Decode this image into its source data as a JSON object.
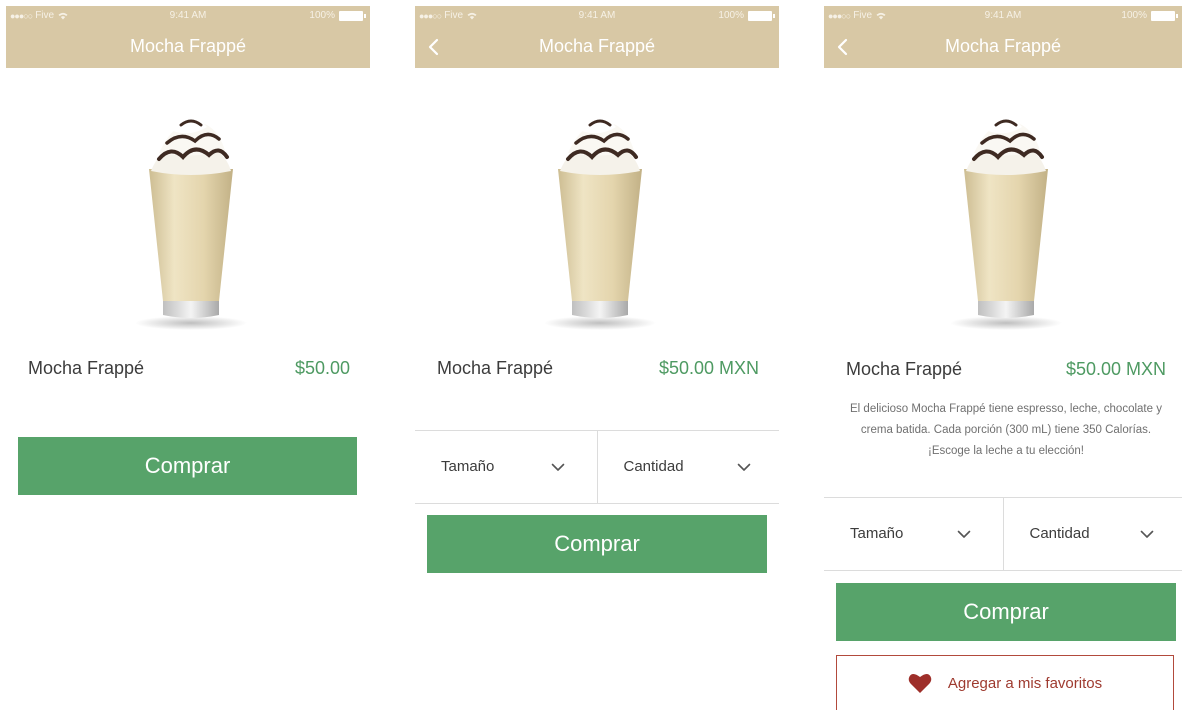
{
  "status_bar": {
    "signal": "●●●○○",
    "carrier": "Five",
    "time": "9:41 AM",
    "battery": "100%"
  },
  "nav": {
    "title": "Mocha Frappé"
  },
  "product": {
    "name": "Mocha Frappé",
    "price_v1": "$50.00",
    "price_v2": "$50.00 MXN",
    "description": "El delicioso Mocha Frappé tiene espresso, leche, chocolate y crema batida. Cada porción (300 mL) tiene 350 Calorías. ¡Escoge la leche a tu elección!"
  },
  "options": {
    "size_label": "Tamaño",
    "quantity_label": "Cantidad"
  },
  "buttons": {
    "buy_label": "Comprar",
    "favorite_label": "Agregar a mis favoritos"
  },
  "colors": {
    "navbar": "#d8c8a5",
    "price": "#4e9a62",
    "buy_button": "#57a36a",
    "favorite_accent": "#b24a3c"
  },
  "icons": [
    "wifi-icon",
    "battery-icon",
    "back-chevron-icon",
    "chevron-down-icon",
    "heart-icon"
  ]
}
